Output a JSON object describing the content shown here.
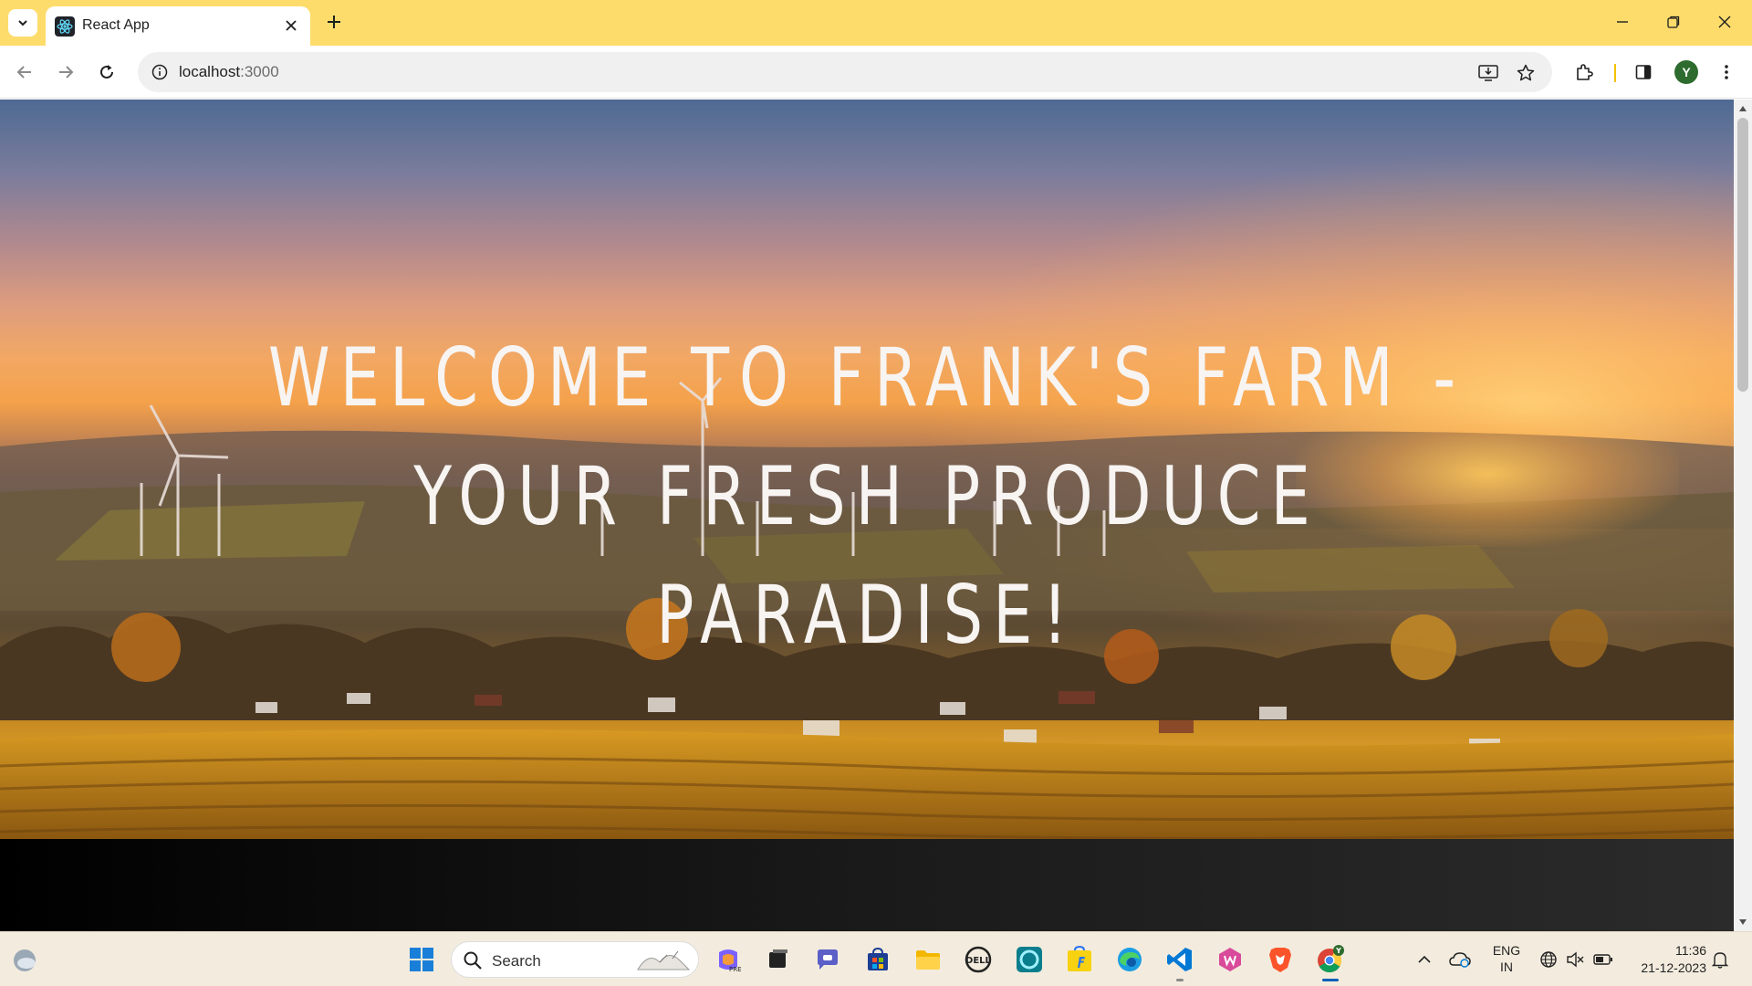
{
  "browser": {
    "tab_title": "React App",
    "url_host": "localhost",
    "url_port": ":3000",
    "profile_initial": "Y",
    "accent_color": "#fddc6c"
  },
  "hero": {
    "title": "WELCOME TO FRANK'S FARM - YOUR FRESH PRODUCE PARADISE!"
  },
  "taskbar": {
    "search_placeholder": "Search",
    "language_line1": "ENG",
    "language_line2": "IN",
    "time": "11:36",
    "date": "21-12-2023",
    "pinned_apps": [
      "start",
      "copilot",
      "task-view",
      "teams",
      "store",
      "file-explorer",
      "dell",
      "alexa",
      "flipkart",
      "edge",
      "vscode",
      "wps",
      "brave",
      "chrome"
    ]
  }
}
